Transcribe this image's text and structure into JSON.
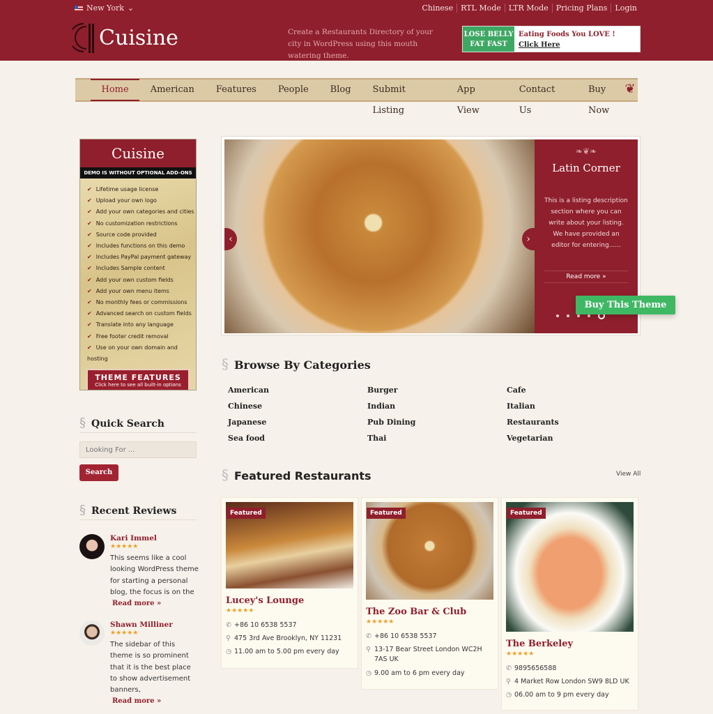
{
  "topbar": {
    "city": "New York",
    "links": [
      "Chinese",
      "RTL Mode",
      "LTR Mode",
      "Pricing Plans",
      "Login"
    ]
  },
  "header": {
    "logo_text": "Cuisine",
    "tagline": "Create a Restaurants Directory of your city in WordPress using this mouth watering theme.",
    "ad": {
      "left": "LOSE BELLY FAT FAST",
      "headline": "Eating Foods You LOVE !",
      "cta": "Click Here"
    }
  },
  "nav": {
    "items": [
      "Home",
      "American",
      "Features",
      "People",
      "Blog",
      "Submit Listing",
      "App View",
      "Contact Us",
      "Buy Now"
    ],
    "active": "Home"
  },
  "promo": {
    "logo": "Cuisine",
    "bar": "DEMO IS WITHOUT OPTIONAL ADD-ONS",
    "features": [
      "Lifetime usage license",
      "Upload your own logo",
      "Add your own categories and cities",
      "No customization restrictions",
      "Source code provided",
      "Includes functions on this demo",
      "Includes PayPal payment gateway",
      "Includes Sample content",
      "Add your own custom fields",
      "Add your own menu items",
      "No monthly fees or commissions",
      "Advanced search on custom fields",
      "Translate into any language",
      "Free footer credit removal",
      "Use on your own domain and hosting"
    ],
    "button_title": "THEME FEATURES",
    "button_sub": "Click here to see all built-in options"
  },
  "quick_search": {
    "title": "Quick Search",
    "placeholder": "Looking For ...",
    "button": "Search"
  },
  "recent_reviews": {
    "title": "Recent Reviews",
    "items": [
      {
        "name": "Kari Immel",
        "stars": "★★★★★",
        "rating": 5,
        "text": "This seems like a cool looking WordPress theme for starting a personal blog, the focus is on the",
        "more": "Read more »"
      },
      {
        "name": "Shawn Milliner",
        "stars": "★★★★★",
        "rating": 5,
        "text": "The sidebar of this theme is so prominent that it is the best place to show advertisement banners,",
        "more": "Read more »"
      }
    ]
  },
  "slider": {
    "title": "Latin Corner",
    "description": "This is a listing description section where you can write about your listing. We have provided an editor for entering......",
    "read_more": "Read more »",
    "slides": 5,
    "active_slide": 5
  },
  "buy_button": "Buy This Theme",
  "categories": {
    "title": "Browse By Categories",
    "items": [
      "American",
      "Burger",
      "Cafe",
      "Chinese",
      "Indian",
      "Italian",
      "Japanese",
      "Pub Dining",
      "Restaurants",
      "Sea food",
      "Thai",
      "Vegetarian"
    ]
  },
  "featured": {
    "title": "Featured Restaurants",
    "view_all": "View All",
    "badge": "Featured",
    "items": [
      {
        "name": "Lucey's Lounge",
        "stars": "★★★★★",
        "phone": "+86 10 6538 5537",
        "address": "475 3rd Ave Brooklyn, NY 11231",
        "hours": "11.00 am to 5.00 pm every day"
      },
      {
        "name": "The Zoo Bar & Club",
        "stars": "★★★★★",
        "phone": "+86 10 6538 5537",
        "address": "13-17 Bear Street London WC2H 7AS UK",
        "hours": "9.00 am to 6 pm every day"
      },
      {
        "name": "The Berkeley",
        "stars": "★★★★★",
        "phone": "9895656588",
        "address": "4 Market Row London SW9 8LD UK",
        "hours": "06.00 am to 9 pm every day"
      }
    ]
  }
}
